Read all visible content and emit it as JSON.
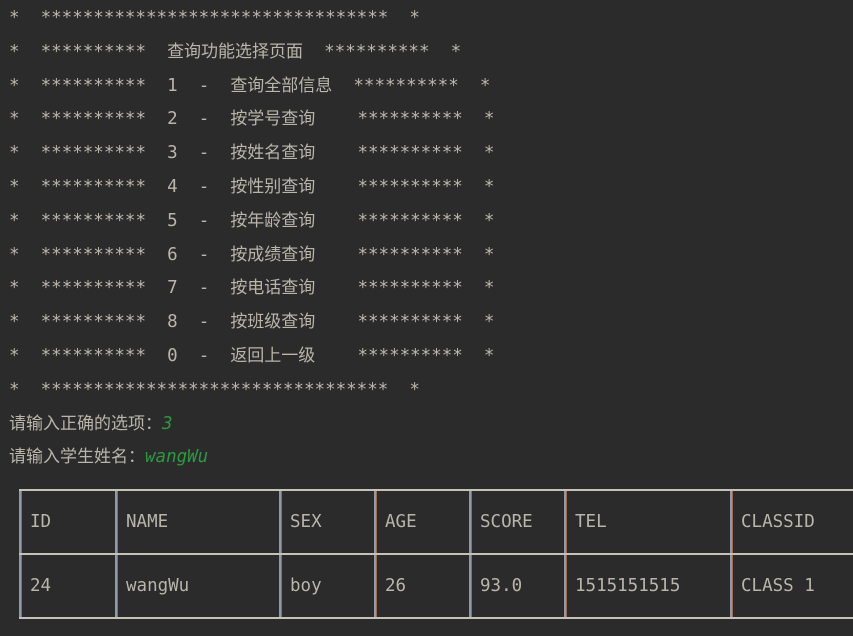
{
  "terminal": {
    "background_color": "#2b2b2b",
    "foreground_color": "#b9b5ab",
    "input_color": "#2a9a3f",
    "border_color": "#c6c2b8"
  },
  "banner": {
    "top_rule": "*  *********************************  *",
    "title_line": "*  **********  查询功能选择页面  **********  *",
    "bottom_rule": "*  *********************************  *",
    "title_text": "查询功能选择页面",
    "left_star": "*",
    "right_star": "*",
    "star_group": "**********"
  },
  "menu": {
    "items": [
      {
        "key": "1",
        "dash": "-",
        "label": "查询全部信息",
        "trailing_pad": ""
      },
      {
        "key": "2",
        "dash": "-",
        "label": "按学号查询",
        "trailing_pad": "  "
      },
      {
        "key": "3",
        "dash": "-",
        "label": "按姓名查询",
        "trailing_pad": "  "
      },
      {
        "key": "4",
        "dash": "-",
        "label": "按性别查询",
        "trailing_pad": "  "
      },
      {
        "key": "5",
        "dash": "-",
        "label": "按年龄查询",
        "trailing_pad": "  "
      },
      {
        "key": "6",
        "dash": "-",
        "label": "按成绩查询",
        "trailing_pad": "  "
      },
      {
        "key": "7",
        "dash": "-",
        "label": "按电话查询",
        "trailing_pad": "  "
      },
      {
        "key": "8",
        "dash": "-",
        "label": "按班级查询",
        "trailing_pad": "  "
      },
      {
        "key": "0",
        "dash": "-",
        "label": "返回上一级",
        "trailing_pad": "  "
      }
    ]
  },
  "prompts": [
    {
      "label": "请输入正确的选项：",
      "value": "3"
    },
    {
      "label": "请输入学生姓名：",
      "value": "wangWu"
    }
  ],
  "result_table": {
    "headers": [
      "ID",
      "NAME",
      "SEX",
      "AGE",
      "SCORE",
      "TEL",
      "CLASSID"
    ],
    "rows": [
      [
        "24",
        "wangWu",
        "boy",
        "26",
        "93.0",
        "1515151515",
        "CLASS 1"
      ]
    ]
  }
}
